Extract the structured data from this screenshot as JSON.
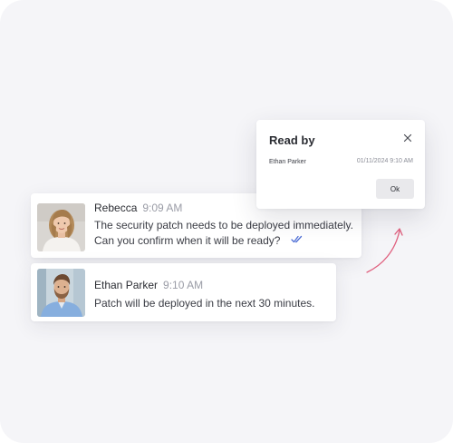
{
  "messages": [
    {
      "sender": "Rebecca",
      "time": "9:09 AM",
      "lines": [
        "The security patch needs to be deployed immediately.",
        "Can you confirm when it will be ready?"
      ],
      "status_icon": "double-check-icon"
    },
    {
      "sender": "Ethan Parker",
      "time": "9:10 AM",
      "lines": [
        "Patch will be deployed in the next 30 minutes."
      ]
    }
  ],
  "read_by_popup": {
    "title": "Read by",
    "readers": [
      {
        "name": "Ethan Parker",
        "read_at": "01/11/2024 9:10 AM"
      }
    ],
    "ok_label": "Ok",
    "close_icon": "close-icon"
  },
  "colors": {
    "background": "#f5f5f8",
    "card": "#ffffff",
    "read_tick": "#4f6fd6",
    "arrow": "#e0607e",
    "ok_button": "#e9e9ec"
  }
}
